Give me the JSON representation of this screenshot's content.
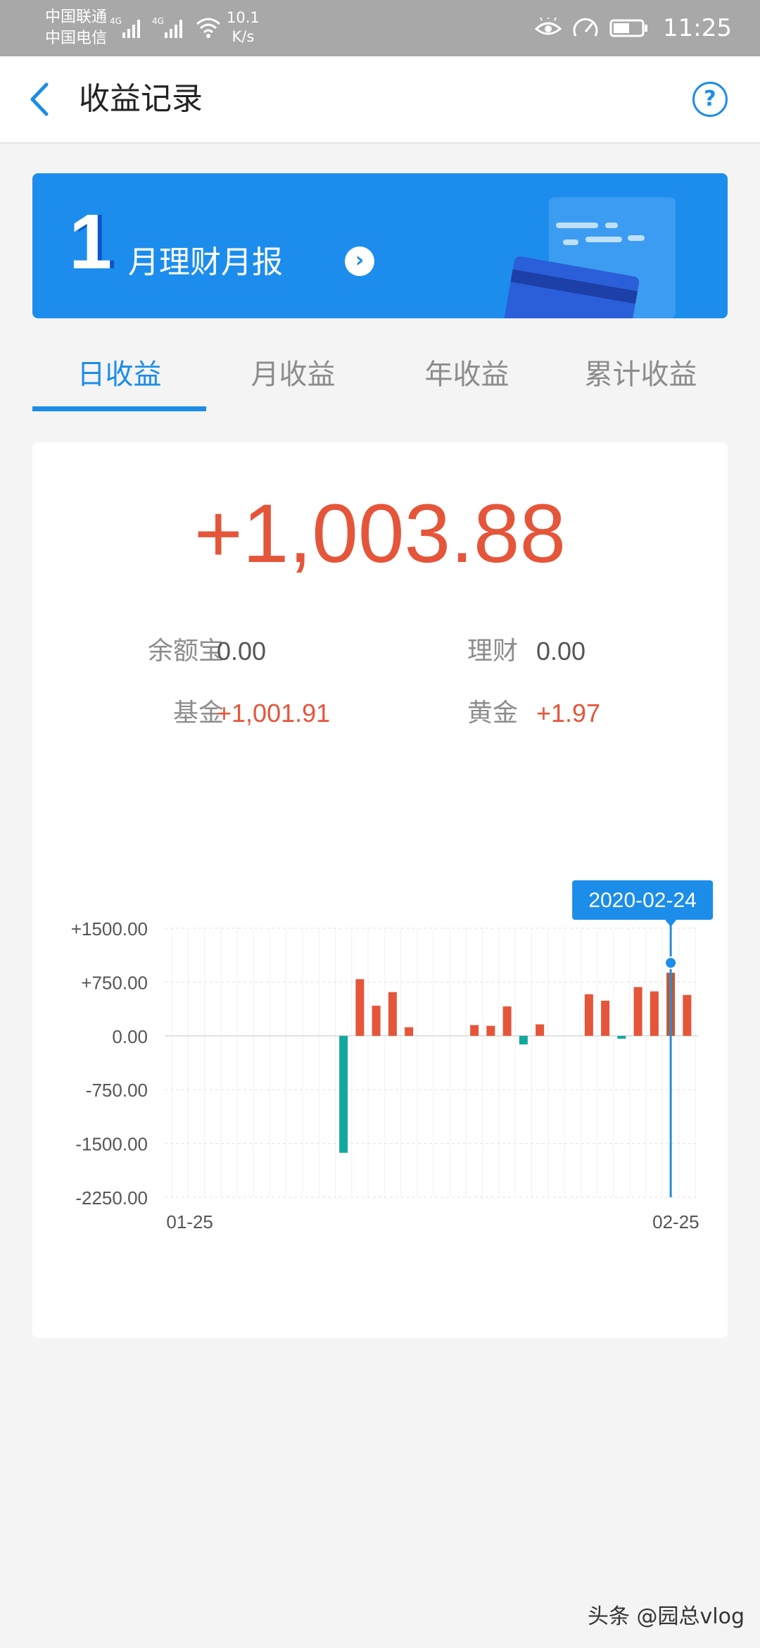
{
  "status_bar": {
    "carrier1": "中国联通",
    "carrier2": "中国电信",
    "net1": "4G",
    "net2": "4G",
    "speed_value": "10.1",
    "speed_unit": "K/s",
    "time": "11:25"
  },
  "header": {
    "title": "收益记录"
  },
  "banner": {
    "month": "1",
    "title": "月理财月报"
  },
  "tabs": [
    {
      "label": "日收益",
      "active": true
    },
    {
      "label": "月收益",
      "active": false
    },
    {
      "label": "年收益",
      "active": false
    },
    {
      "label": "累计收益",
      "active": false
    }
  ],
  "summary": {
    "total": "+1,003.88",
    "items": [
      {
        "label": "余额宝",
        "value": "0.00"
      },
      {
        "label": "理财",
        "value": "0.00"
      },
      {
        "label": "基金",
        "value": "+1,001.91"
      },
      {
        "label": "黄金",
        "value": "+1.97"
      }
    ]
  },
  "colors": {
    "accent": "#1c8de8",
    "positive": "#e5553a",
    "negative": "#13a89e"
  },
  "chart_data": {
    "type": "bar",
    "tooltip": "2020-02-24",
    "x_start_label": "01-25",
    "x_end_label": "02-25",
    "y_ticks": [
      "+1500.00",
      "+750.00",
      "0.00",
      "-750.00",
      "-1500.00",
      "-2250.00"
    ],
    "y_tick_values": [
      1500,
      750,
      0,
      -750,
      -1500,
      -2250
    ],
    "ylim": [
      -2250,
      1500
    ],
    "dates": [
      "01-25",
      "01-26",
      "01-27",
      "01-28",
      "01-29",
      "01-30",
      "01-31",
      "02-01",
      "02-02",
      "02-03",
      "02-04",
      "02-05",
      "02-06",
      "02-07",
      "02-08",
      "02-09",
      "02-10",
      "02-11",
      "02-12",
      "02-13",
      "02-14",
      "02-15",
      "02-16",
      "02-17",
      "02-18",
      "02-19",
      "02-20",
      "02-21",
      "02-22",
      "02-23",
      "02-24",
      "02-25"
    ],
    "values": [
      0,
      0,
      0,
      0,
      0,
      0,
      0,
      0,
      0,
      0,
      -1630,
      790,
      420,
      610,
      120,
      0,
      0,
      0,
      150,
      140,
      410,
      -120,
      160,
      0,
      0,
      580,
      490,
      -40,
      680,
      620,
      880,
      570
    ],
    "highlight_date": "02-24"
  },
  "watermark": "头条 @园总vlog"
}
